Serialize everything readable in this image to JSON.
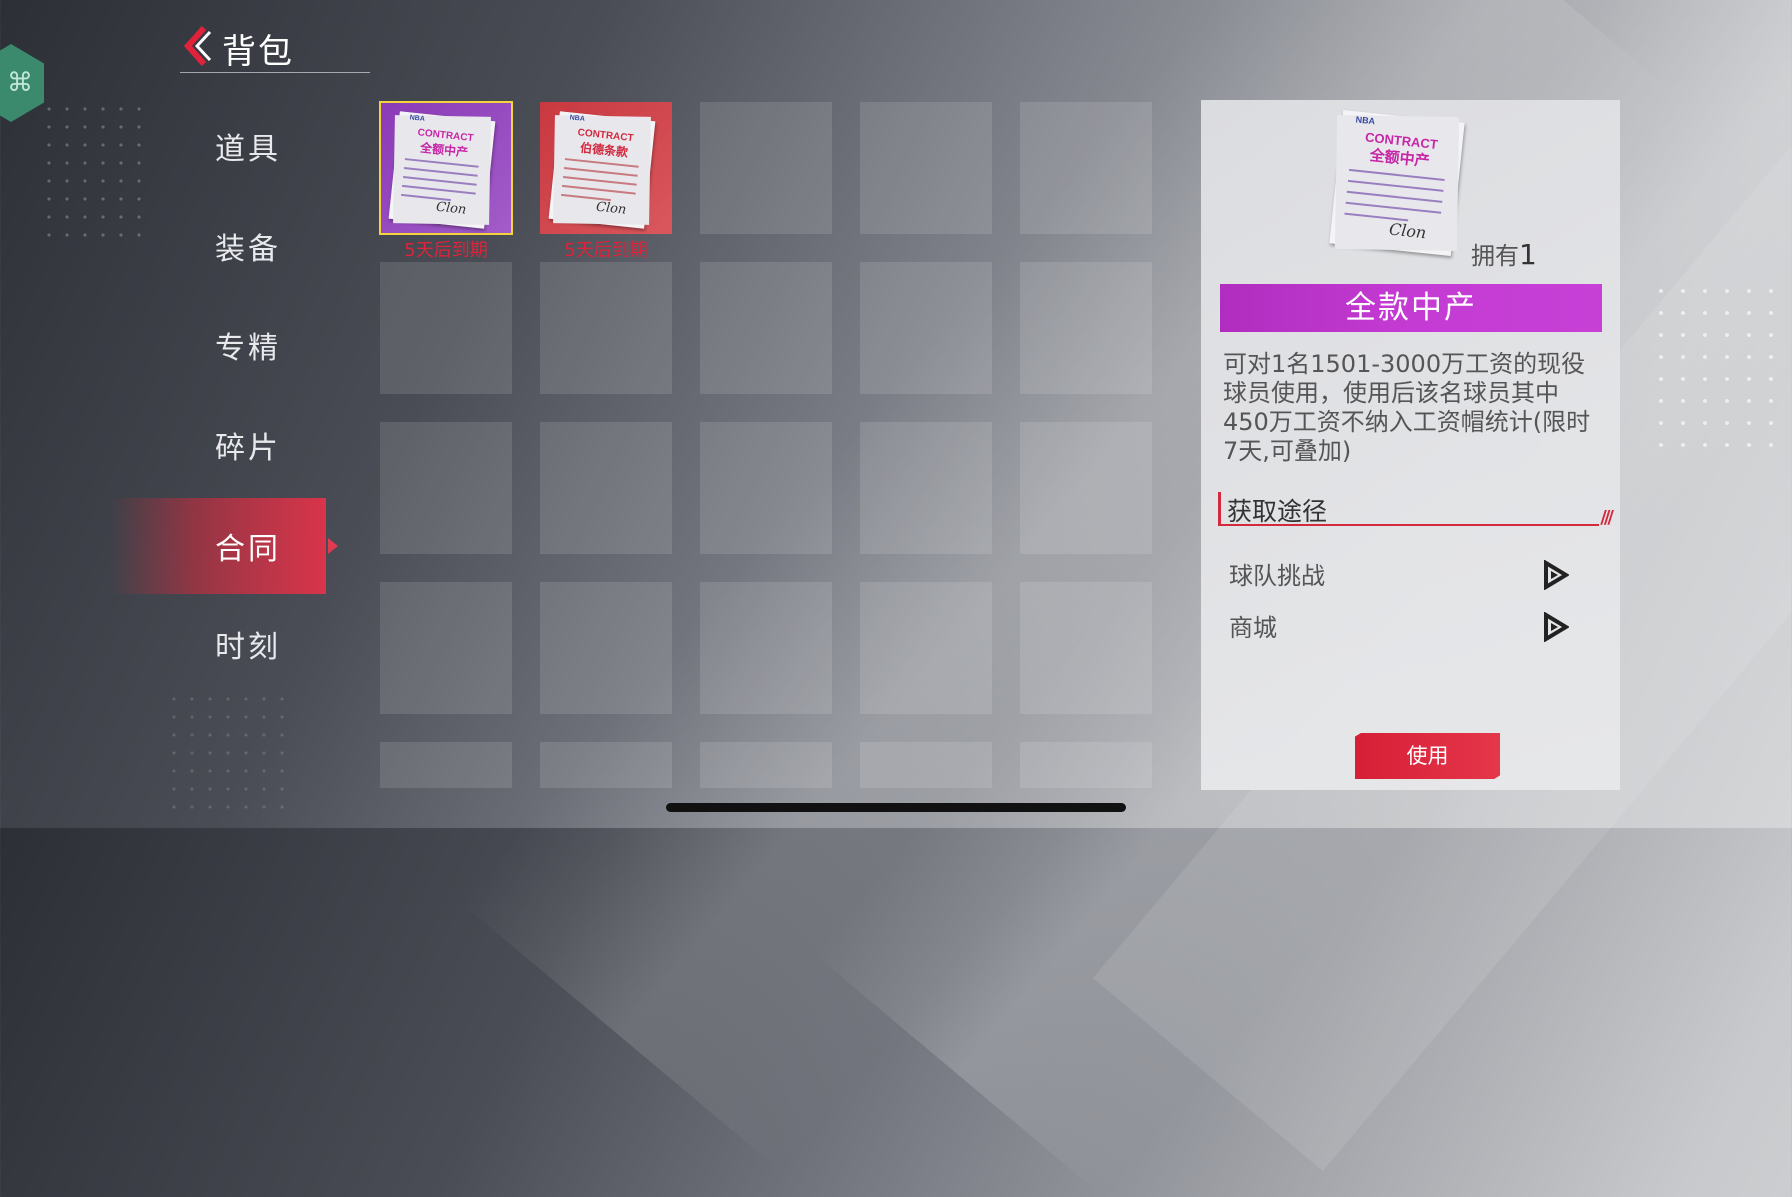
{
  "header": {
    "title": "背包"
  },
  "nav": {
    "items": [
      {
        "label": "道具",
        "active": false
      },
      {
        "label": "装备",
        "active": false
      },
      {
        "label": "专精",
        "active": false
      },
      {
        "label": "碎片",
        "active": false
      },
      {
        "label": "合同",
        "active": true
      },
      {
        "label": "时刻",
        "active": false
      }
    ]
  },
  "inventory": {
    "items": [
      {
        "doc_brand": "NBA",
        "doc_word": "CONTRACT",
        "doc_title": "全额中产",
        "signature": "Clon",
        "expiry": "5天后到期",
        "color": "#8a3ab6",
        "selected": true
      },
      {
        "doc_brand": "NBA",
        "doc_word": "CONTRACT",
        "doc_title": "伯德条款",
        "signature": "Clon",
        "expiry": "5天后到期",
        "color": "#c8383f",
        "selected": false
      }
    ]
  },
  "detail": {
    "doc_brand": "NBA",
    "doc_word": "CONTRACT",
    "doc_title": "全额中产",
    "signature": "Clon",
    "owned_label": "拥有",
    "owned_count": "1",
    "name": "全款中产",
    "description": "可对1名1501-3000万工资的现役球员使用，使用后该名球员其中450万工资不纳入工资帽统计(限时7天,可叠加)",
    "source_title": "获取途径",
    "sources": [
      {
        "label": "球队挑战"
      },
      {
        "label": "商城"
      }
    ],
    "use_label": "使用",
    "banner_color": "#c43bd3",
    "use_color": "#d61f36"
  },
  "colors": {
    "accent_red": "#d9344a",
    "expiry_red": "#e0223a",
    "select_yellow": "#f3d43a"
  }
}
